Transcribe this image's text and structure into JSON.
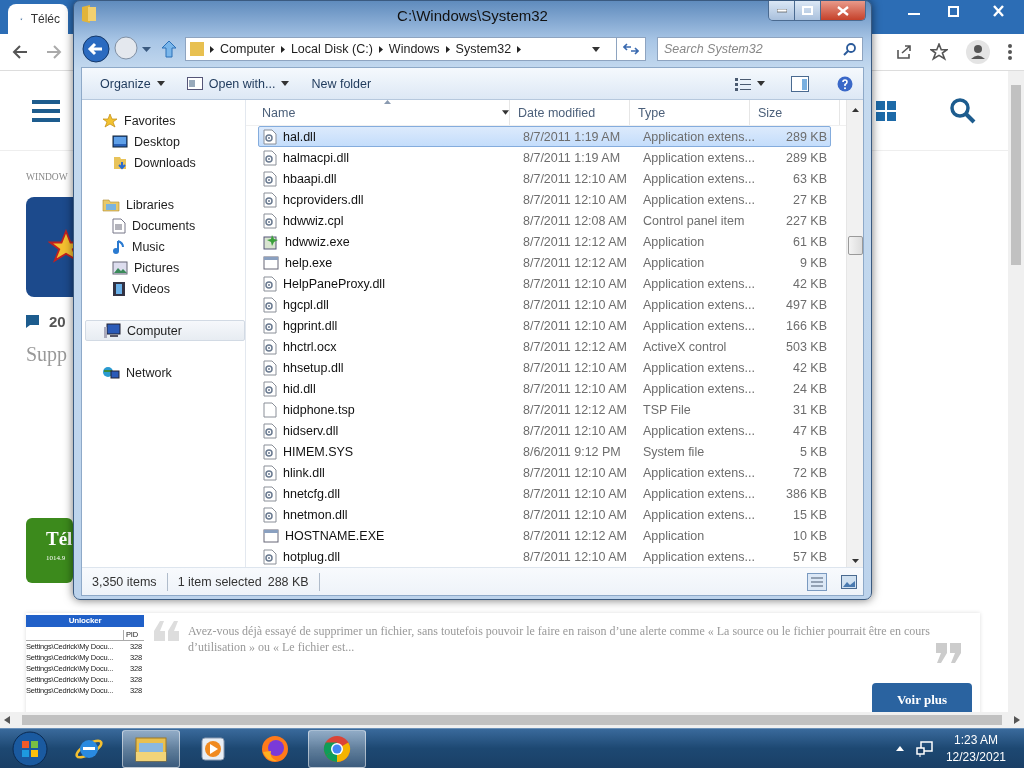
{
  "browser": {
    "tab_title": "Téléc",
    "page": {
      "breadcrumb": "WINDOW",
      "comment_count": "20",
      "heading": "Supp",
      "download_button": {
        "label": "Tél",
        "size": "1014.9"
      },
      "article": {
        "thumbnail": {
          "title": "Unlocker",
          "column": "PID",
          "rows": [
            {
              "path": "Settings\\Cedrick\\My Docu...",
              "pid": "328"
            },
            {
              "path": "Settings\\Cedrick\\My Docu...",
              "pid": "328"
            },
            {
              "path": "Settings\\Cedrick\\My Docu...",
              "pid": "328"
            },
            {
              "path": "Settings\\Cedrick\\My Docu...",
              "pid": "328"
            },
            {
              "path": "Settings\\Cedrick\\My Docu...",
              "pid": "328"
            }
          ]
        },
        "excerpt": "Avez-vous déjà essayé de supprimer un fichier, sans toutefois pouvoir le faire en raison d’une alerte comme « La source ou le fichier pourrait être en cours d’utilisation » ou « Le fichier est...",
        "button": "Voir plus"
      }
    }
  },
  "explorer": {
    "title": "C:\\Windows\\System32",
    "address": [
      "Computer",
      "Local Disk (C:)",
      "Windows",
      "System32"
    ],
    "search": {
      "placeholder": "Search System32"
    },
    "commands": [
      {
        "label": "Organize",
        "menu": true
      },
      {
        "label": "Open with...",
        "menu": true
      },
      {
        "label": "New folder",
        "menu": false
      }
    ],
    "nav": [
      {
        "label": "Favorites",
        "selected": false,
        "children": [
          {
            "label": "Desktop",
            "selected": false
          },
          {
            "label": "Downloads",
            "selected": false
          }
        ]
      },
      {
        "label": "Libraries",
        "selected": false,
        "children": [
          {
            "label": "Documents",
            "selected": false
          },
          {
            "label": "Music",
            "selected": false
          },
          {
            "label": "Pictures",
            "selected": false
          },
          {
            "label": "Videos",
            "selected": false
          }
        ]
      },
      {
        "label": "Computer",
        "selected": true
      },
      {
        "label": "Network",
        "selected": false
      }
    ],
    "columns": [
      {
        "label": "Name",
        "sorted": true
      },
      {
        "label": "Date modified",
        "sorted": false
      },
      {
        "label": "Type",
        "sorted": false
      },
      {
        "label": "Size",
        "sorted": false
      }
    ],
    "files": [
      {
        "name": "hal.dll",
        "date": "8/7/2011 1:19 AM",
        "type": "Application extens...",
        "size": "289 KB",
        "kind": "dll",
        "selected": true
      },
      {
        "name": "halmacpi.dll",
        "date": "8/7/2011 1:19 AM",
        "type": "Application extens...",
        "size": "289 KB",
        "kind": "dll",
        "selected": false
      },
      {
        "name": "hbaapi.dll",
        "date": "8/7/2011 12:10 AM",
        "type": "Application extens...",
        "size": "63 KB",
        "kind": "dll",
        "selected": false
      },
      {
        "name": "hcproviders.dll",
        "date": "8/7/2011 12:10 AM",
        "type": "Application extens...",
        "size": "27 KB",
        "kind": "dll",
        "selected": false
      },
      {
        "name": "hdwwiz.cpl",
        "date": "8/7/2011 12:08 AM",
        "type": "Control panel item",
        "size": "227 KB",
        "kind": "dll",
        "selected": false
      },
      {
        "name": "hdwwiz.exe",
        "date": "8/7/2011 12:12 AM",
        "type": "Application",
        "size": "61 KB",
        "kind": "wizard",
        "selected": false
      },
      {
        "name": "help.exe",
        "date": "8/7/2011 12:12 AM",
        "type": "Application",
        "size": "9 KB",
        "kind": "exe",
        "selected": false
      },
      {
        "name": "HelpPaneProxy.dll",
        "date": "8/7/2011 12:10 AM",
        "type": "Application extens...",
        "size": "42 KB",
        "kind": "dll",
        "selected": false
      },
      {
        "name": "hgcpl.dll",
        "date": "8/7/2011 12:10 AM",
        "type": "Application extens...",
        "size": "497 KB",
        "kind": "dll",
        "selected": false
      },
      {
        "name": "hgprint.dll",
        "date": "8/7/2011 12:10 AM",
        "type": "Application extens...",
        "size": "166 KB",
        "kind": "dll",
        "selected": false
      },
      {
        "name": "hhctrl.ocx",
        "date": "8/7/2011 12:12 AM",
        "type": "ActiveX control",
        "size": "503 KB",
        "kind": "dll",
        "selected": false
      },
      {
        "name": "hhsetup.dll",
        "date": "8/7/2011 12:10 AM",
        "type": "Application extens...",
        "size": "42 KB",
        "kind": "dll",
        "selected": false
      },
      {
        "name": "hid.dll",
        "date": "8/7/2011 12:10 AM",
        "type": "Application extens...",
        "size": "24 KB",
        "kind": "dll",
        "selected": false
      },
      {
        "name": "hidphone.tsp",
        "date": "8/7/2011 12:12 AM",
        "type": "TSP File",
        "size": "31 KB",
        "kind": "file",
        "selected": false
      },
      {
        "name": "hidserv.dll",
        "date": "8/7/2011 12:10 AM",
        "type": "Application extens...",
        "size": "47 KB",
        "kind": "dll",
        "selected": false
      },
      {
        "name": "HIMEM.SYS",
        "date": "8/6/2011 9:12 PM",
        "type": "System file",
        "size": "5 KB",
        "kind": "dll",
        "selected": false
      },
      {
        "name": "hlink.dll",
        "date": "8/7/2011 12:10 AM",
        "type": "Application extens...",
        "size": "72 KB",
        "kind": "dll",
        "selected": false
      },
      {
        "name": "hnetcfg.dll",
        "date": "8/7/2011 12:10 AM",
        "type": "Application extens...",
        "size": "386 KB",
        "kind": "dll",
        "selected": false
      },
      {
        "name": "hnetmon.dll",
        "date": "8/7/2011 12:10 AM",
        "type": "Application extens...",
        "size": "15 KB",
        "kind": "dll",
        "selected": false
      },
      {
        "name": "HOSTNAME.EXE",
        "date": "8/7/2011 12:12 AM",
        "type": "Application",
        "size": "10 KB",
        "kind": "exe",
        "selected": false
      },
      {
        "name": "hotplug.dll",
        "date": "8/7/2011 12:10 AM",
        "type": "Application extens...",
        "size": "57 KB",
        "kind": "dll",
        "selected": false
      }
    ],
    "status": {
      "count": "3,350 items",
      "selection": "1 item selected",
      "selection_size": "288 KB"
    }
  },
  "taskbar": {
    "apps": [
      {
        "kind": "ie",
        "open": false
      },
      {
        "kind": "explorer",
        "open": true
      },
      {
        "kind": "media",
        "open": false
      },
      {
        "kind": "firefox",
        "open": false
      },
      {
        "kind": "chrome",
        "open": true
      }
    ],
    "time": "1:23 AM",
    "date": "12/23/2021"
  }
}
